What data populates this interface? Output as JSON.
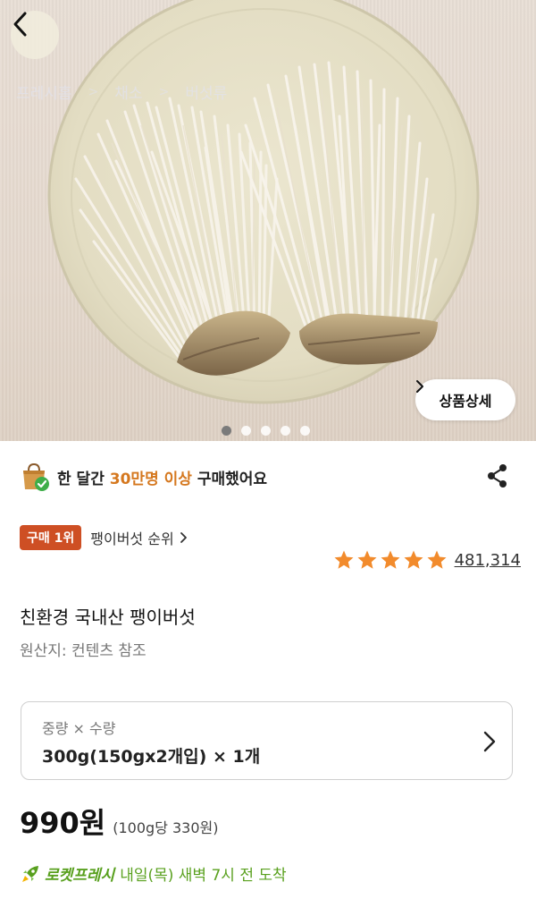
{
  "header": {
    "back_icon": "chevron-left-icon",
    "breadcrumb": [
      "프레시홈",
      "채소",
      "버섯류"
    ]
  },
  "hero": {
    "detail_button_label": "상품상세",
    "carousel_total": 5,
    "carousel_active": 1
  },
  "purchase_stat": {
    "prefix": "한 달간",
    "highlight": "30만명 이상",
    "suffix": "구매했어요",
    "highlight_color": "#d5781f"
  },
  "rank": {
    "badge": "구매 1위",
    "link": "팽이버섯 순위"
  },
  "rating": {
    "stars": 5,
    "review_count": "481,314",
    "star_color": "#f28b2c"
  },
  "product": {
    "name": "친환경 국내산 팽이버섯",
    "origin": "원산지: 컨텐츠 참조"
  },
  "option": {
    "label": "중량 × 수량",
    "value": "300g(150gx2개입) × 1개"
  },
  "price": {
    "amount": "990원",
    "unit_price": "(100g당 330원)"
  },
  "delivery": {
    "service": "로켓프레시",
    "text": "내일(목) 새벽 7시 전  도착",
    "color": "#58a01e"
  }
}
